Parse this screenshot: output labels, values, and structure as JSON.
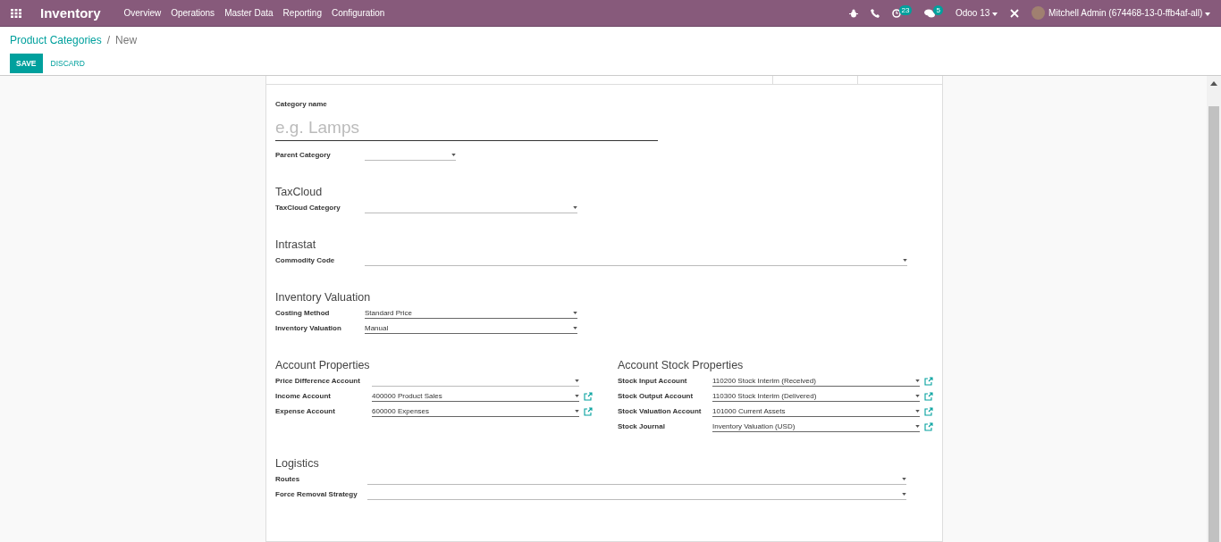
{
  "navbar": {
    "app": "Inventory",
    "menu": [
      "Overview",
      "Operations",
      "Master Data",
      "Reporting",
      "Configuration"
    ],
    "activity_count": "23",
    "message_count": "5",
    "database": "Odoo 13",
    "user": "Mitchell Admin (674468-13-0-ffb4af-all)"
  },
  "breadcrumb": {
    "parent": "Product Categories",
    "separator": "/",
    "current": "New"
  },
  "buttons": {
    "save": "SAVE",
    "discard": "DISCARD"
  },
  "name_field": {
    "label": "Category name",
    "placeholder": "e.g. Lamps"
  },
  "parent_field": {
    "label": "Parent Category",
    "kind": "short"
  },
  "groups": [
    {
      "title": "TaxCloud",
      "fields": [
        {
          "label": "TaxCloud Category",
          "kind": "medium"
        }
      ]
    },
    {
      "title": "Intrastat",
      "fields": [
        {
          "label": "Commodity Code",
          "kind": "wide"
        }
      ]
    },
    {
      "title": "Inventory Valuation",
      "fields": [
        {
          "label": "Costing Method",
          "value": "Standard Price",
          "kind": "medium"
        },
        {
          "label": "Inventory Valuation",
          "value": "Manual",
          "kind": "medium"
        }
      ]
    }
  ],
  "account_columns": [
    {
      "title": "Account Properties",
      "fields": [
        {
          "label": "Price Difference Account"
        },
        {
          "label": "Income Account",
          "value": "400000 Product Sales"
        },
        {
          "label": "Expense Account",
          "value": "600000 Expenses"
        }
      ]
    },
    {
      "title": "Account Stock Properties",
      "fields": [
        {
          "label": "Stock Input Account",
          "value": "110200 Stock Interim (Received)"
        },
        {
          "label": "Stock Output Account",
          "value": "110300 Stock Interim (Delivered)"
        },
        {
          "label": "Stock Valuation Account",
          "value": "101000 Current Assets"
        },
        {
          "label": "Stock Journal",
          "value": "Inventory Valuation (USD)"
        }
      ]
    }
  ],
  "logistics": {
    "title": "Logistics",
    "fields": [
      {
        "label": "Routes"
      },
      {
        "label": "Force Removal Strategy"
      }
    ]
  }
}
